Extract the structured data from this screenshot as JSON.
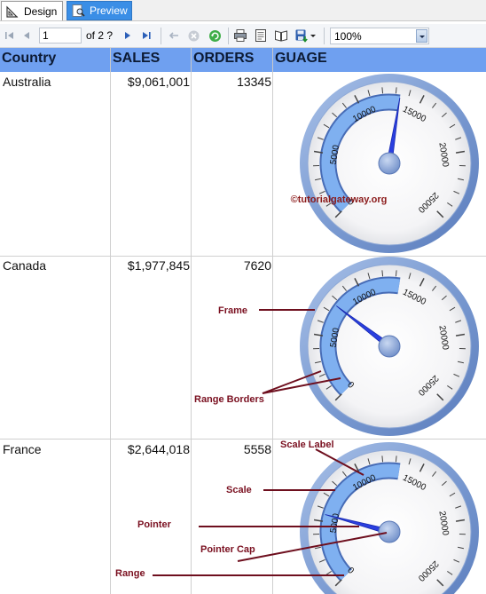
{
  "tabs": {
    "design_label": "Design",
    "preview_label": "Preview"
  },
  "toolbar": {
    "page_number": "1",
    "page_of": "of 2 ?",
    "zoom": "100%"
  },
  "table": {
    "headers": {
      "country": "Country",
      "sales": "SALES",
      "orders": "ORDERS",
      "gauge": "GUAGE"
    },
    "rows": [
      {
        "country": "Australia",
        "sales": "$9,061,001",
        "orders": "13345",
        "gauge_value": 13345
      },
      {
        "country": "Canada",
        "sales": "$1,977,845",
        "orders": "7620",
        "gauge_value": 7620
      },
      {
        "country": "France",
        "sales": "$2,644,018",
        "orders": "5558",
        "gauge_value": 5558
      }
    ]
  },
  "gauge": {
    "scale_labels": [
      "0",
      "5000",
      "10000",
      "15000",
      "20000",
      "25000"
    ],
    "min": 0,
    "max": 25000,
    "range_end": 13345
  },
  "watermark": "©tutorialgateway.org",
  "annotations": {
    "frame": "Frame",
    "range_borders": "Range Borders",
    "scale_label": "Scale Label",
    "scale": "Scale",
    "pointer": "Pointer",
    "pointer_cap": "Pointer Cap",
    "range": "Range"
  },
  "colors": {
    "header_bg": "#6fa0f0",
    "tab_active": "#3a8ee6",
    "gauge_frame": "#7e9fd4",
    "gauge_range": "#6b9ee6",
    "pointer": "#2a3fe0",
    "annotation_text": "#7a1020",
    "annotation_line": "#6e0f1e"
  }
}
